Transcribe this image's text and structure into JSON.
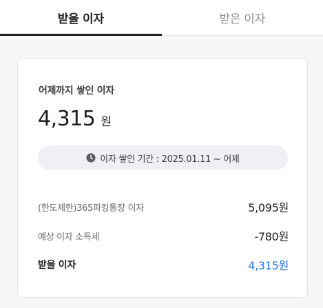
{
  "tabs": [
    {
      "label": "받을 이자",
      "active": true
    },
    {
      "label": "받은 이자",
      "active": false
    }
  ],
  "card": {
    "title": "어제까지 쌓인 이자",
    "amount": "4,315",
    "amount_unit": "원",
    "period_text": "이자 쌓인 기간 : 2025.01.11 ~ 어제",
    "period_icon": "clock-icon",
    "rows": [
      {
        "label": "(한도제한)365파킹통장 이자",
        "value": "5,095원"
      },
      {
        "label": "예상 이자 소득세",
        "value": "-780원"
      },
      {
        "label": "받을 이자",
        "value": "4,315원"
      }
    ]
  },
  "colors": {
    "accent_blue": "#1f6fe0",
    "tab_indicator": "#1f1f1f",
    "period_bg": "#eef0f5"
  }
}
